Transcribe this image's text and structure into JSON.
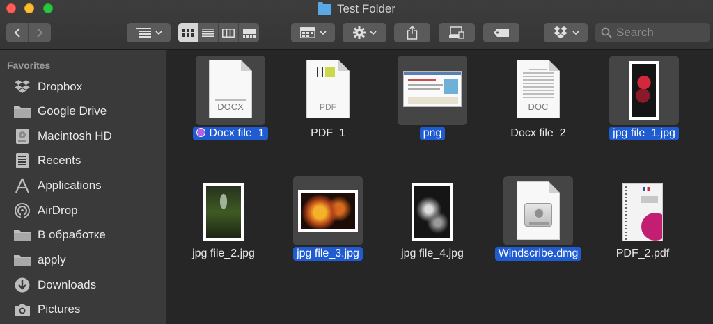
{
  "window": {
    "title": "Test Folder"
  },
  "toolbar": {
    "search_placeholder": "Search",
    "icons": {
      "back": "chevron-left-icon",
      "forward": "chevron-right-icon",
      "arrange": "list-arrange-icon",
      "group": "group-icon",
      "action": "gear-icon",
      "share": "share-icon",
      "connect": "server-icon",
      "tag": "tag-icon",
      "dropbox": "dropbox-icon",
      "search": "search-icon"
    },
    "active_view": "icon"
  },
  "sidebar": {
    "heading": "Favorites",
    "items": [
      {
        "label": "Dropbox",
        "icon": "dropbox-icon"
      },
      {
        "label": "Google Drive",
        "icon": "folder-icon"
      },
      {
        "label": "Macintosh HD",
        "icon": "hard-drive-icon"
      },
      {
        "label": "Recents",
        "icon": "recents-icon"
      },
      {
        "label": "Applications",
        "icon": "applications-icon"
      },
      {
        "label": "AirDrop",
        "icon": "airdrop-icon"
      },
      {
        "label": "В обработке",
        "icon": "folder-icon"
      },
      {
        "label": "apply",
        "icon": "folder-icon"
      },
      {
        "label": "Downloads",
        "icon": "downloads-icon"
      },
      {
        "label": "Pictures",
        "icon": "camera-icon"
      }
    ]
  },
  "files": [
    {
      "name": "Docx file_1",
      "selected": true,
      "tag_color": "#b660e6",
      "kind": "docx",
      "ext": "DOCX"
    },
    {
      "name": "PDF_1",
      "selected": false,
      "kind": "pdf",
      "ext": "PDF"
    },
    {
      "name": "png",
      "selected": true,
      "kind": "screenshot"
    },
    {
      "name": "Docx file_2",
      "selected": false,
      "kind": "docx",
      "ext": "DOC"
    },
    {
      "name": "jpg file_1.jpg",
      "selected": true,
      "kind": "photo-tall"
    },
    {
      "name": "jpg file_2.jpg",
      "selected": false,
      "kind": "photo-tall"
    },
    {
      "name": "jpg file_3.jpg",
      "selected": true,
      "kind": "photo-wide"
    },
    {
      "name": "jpg file_4.jpg",
      "selected": false,
      "kind": "photo-tall"
    },
    {
      "name": "Windscribe.dmg",
      "selected": true,
      "kind": "dmg"
    },
    {
      "name": "PDF_2.pdf",
      "selected": false,
      "kind": "pdf-cover"
    }
  ],
  "colors": {
    "selection": "#1f5bd1",
    "accent_folder": "#5aa9e6"
  }
}
